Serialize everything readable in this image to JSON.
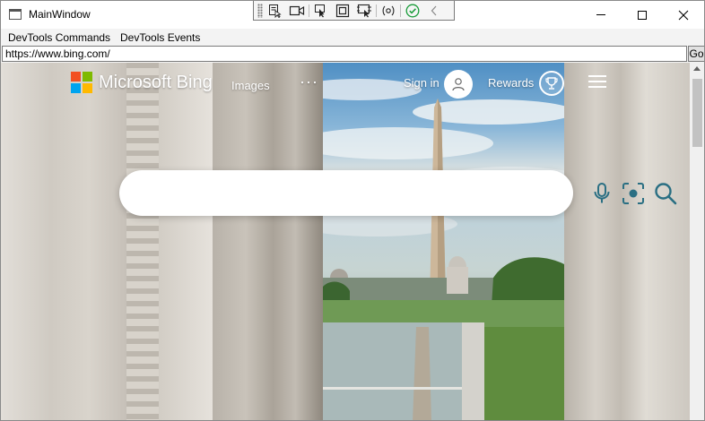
{
  "window": {
    "title": "MainWindow",
    "icon": "window-icon",
    "controls": [
      "minimize-icon",
      "maximize-icon",
      "close-icon"
    ]
  },
  "debug_toolbar": {
    "icons": [
      "select-element-icon",
      "video-record-icon",
      "pointer-icon",
      "layout-box-icon",
      "display-layout-icon",
      "hot-reload-icon",
      "check-status-icon",
      "collapse-chevron-icon"
    ],
    "colors": {
      "check": "#1a9c3a",
      "accent": "#6b3aa0"
    }
  },
  "menu": {
    "items": [
      "DevTools Commands",
      "DevTools Events"
    ]
  },
  "address_bar": {
    "url": "https://www.bing.com/",
    "go_label": "Go"
  },
  "bing": {
    "brand": "Microsoft Bing",
    "logo_colors": [
      "#f25022",
      "#7fba00",
      "#00a4ef",
      "#ffb900"
    ],
    "nav": {
      "images": "Images",
      "more": "···"
    },
    "sign_in": "Sign in",
    "rewards": "Rewards",
    "search": {
      "value": "",
      "icons": [
        "microphone-icon",
        "visual-search-icon",
        "search-icon"
      ],
      "icon_color": "#2a6f83"
    }
  }
}
